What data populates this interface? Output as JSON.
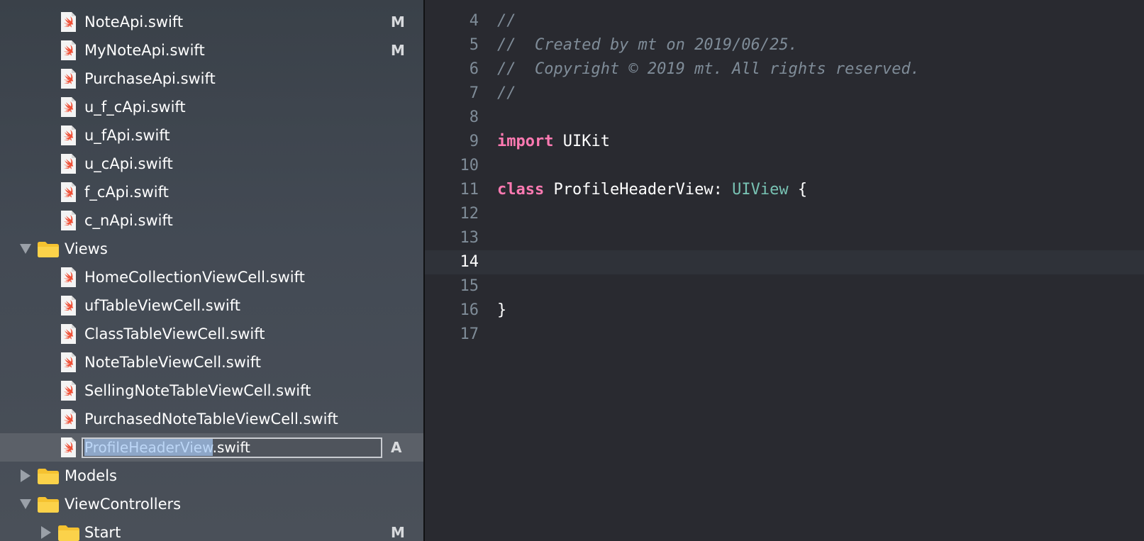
{
  "navigator": {
    "items": [
      {
        "label": "NoteApi.swift",
        "badge": "M"
      },
      {
        "label": "MyNoteApi.swift",
        "badge": "M"
      },
      {
        "label": "PurchaseApi.swift",
        "badge": ""
      },
      {
        "label": "u_f_cApi.swift",
        "badge": ""
      },
      {
        "label": "u_fApi.swift",
        "badge": ""
      },
      {
        "label": "u_cApi.swift",
        "badge": ""
      },
      {
        "label": "f_cApi.swift",
        "badge": ""
      },
      {
        "label": "c_nApi.swift",
        "badge": ""
      },
      {
        "label": "Views",
        "badge": ""
      },
      {
        "label": "HomeCollectionViewCell.swift",
        "badge": ""
      },
      {
        "label": "ufTableViewCell.swift",
        "badge": ""
      },
      {
        "label": "ClassTableViewCell.swift",
        "badge": ""
      },
      {
        "label": "NoteTableViewCell.swift",
        "badge": ""
      },
      {
        "label": "SellingNoteTableViewCell.swift",
        "badge": ""
      },
      {
        "label": "PurchasedNoteTableViewCell.swift",
        "badge": ""
      },
      {
        "label": "ProfileHeaderView.swift",
        "selected_part": "ProfileHeaderView",
        "rest_part": ".swift",
        "badge": "A"
      },
      {
        "label": "Models",
        "badge": ""
      },
      {
        "label": "ViewControllers",
        "badge": ""
      },
      {
        "label": "Start",
        "badge": "M"
      }
    ]
  },
  "editor": {
    "lines": [
      {
        "num": "4",
        "text": "//"
      },
      {
        "num": "5",
        "text": "//  Created by mt on 2019/06/25."
      },
      {
        "num": "6",
        "text": "//  Copyright © 2019 mt. All rights reserved."
      },
      {
        "num": "7",
        "text": "//"
      },
      {
        "num": "8",
        "text": ""
      },
      {
        "num": "9",
        "kw": "import",
        "rest": " UIKit"
      },
      {
        "num": "10",
        "text": ""
      },
      {
        "num": "11",
        "kw": "class",
        "name": " ProfileHeaderView: ",
        "type": "UIView",
        "tail": " {"
      },
      {
        "num": "12",
        "text": ""
      },
      {
        "num": "13",
        "text": ""
      },
      {
        "num": "14",
        "text": ""
      },
      {
        "num": "15",
        "text": ""
      },
      {
        "num": "16",
        "text": "}"
      },
      {
        "num": "17",
        "text": ""
      }
    ]
  }
}
